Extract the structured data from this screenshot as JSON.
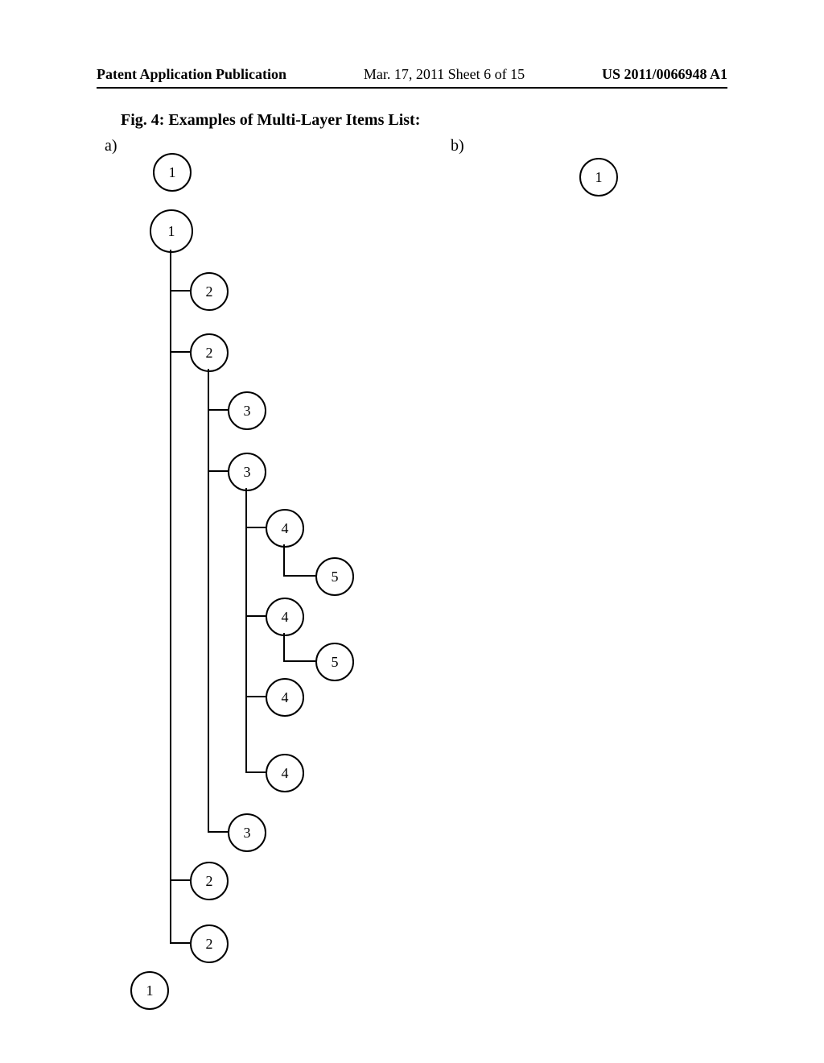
{
  "header": {
    "publication_label": "Patent Application Publication",
    "date_sheet": "Mar. 17, 2011  Sheet 6 of 15",
    "publication_number": "US 2011/0066948 A1"
  },
  "figure": {
    "title": "Fig. 4: Examples of Multi-Layer Items List:",
    "label_a": "a)",
    "label_b": "b)"
  },
  "nodes": {
    "a_top_1": "1",
    "a_l1_1": "1",
    "a_l2_2a": "2",
    "a_l2_2b": "2",
    "a_l3_3a": "3",
    "a_l3_3b": "3",
    "a_l4_4a": "4",
    "a_l5_5a": "5",
    "a_l4_4b": "4",
    "a_l5_5b": "5",
    "a_l4_4c": "4",
    "a_l4_4d": "4",
    "a_l3_3c": "3",
    "a_l2_2c": "2",
    "a_l2_2d": "2",
    "a_bot_1": "1",
    "b_1": "1"
  }
}
